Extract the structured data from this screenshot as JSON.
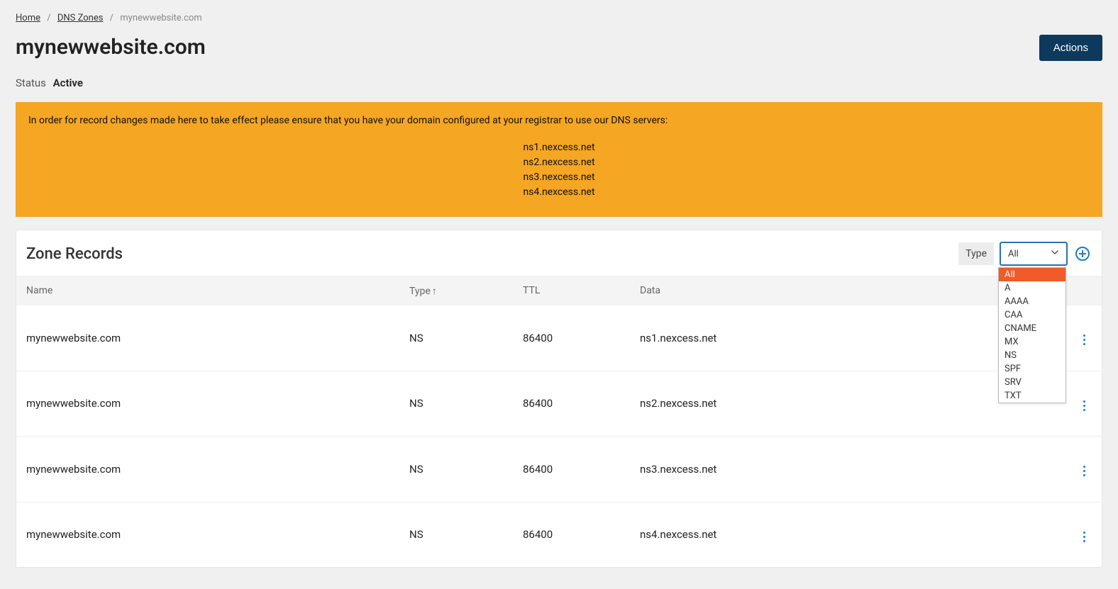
{
  "breadcrumb": {
    "home": "Home",
    "dns_zones": "DNS Zones",
    "current": "mynewwebsite.com"
  },
  "page_title": "mynewwebsite.com",
  "actions_label": "Actions",
  "status": {
    "label": "Status",
    "value": "Active"
  },
  "notice": {
    "text": "In order for record changes made here to take effect please ensure that you have your domain configured at your registrar to use our DNS servers:",
    "ns": [
      "ns1.nexcess.net",
      "ns2.nexcess.net",
      "ns3.nexcess.net",
      "ns4.nexcess.net"
    ]
  },
  "zone_records": {
    "title": "Zone Records",
    "filter": {
      "label": "Type",
      "selected": "All",
      "options": [
        "All",
        "A",
        "AAAA",
        "CAA",
        "CNAME",
        "MX",
        "NS",
        "SPF",
        "SRV",
        "TXT"
      ]
    },
    "columns": {
      "name": "Name",
      "type": "Type",
      "ttl": "TTL",
      "data": "Data",
      "sort_indicator": "↑"
    },
    "rows": [
      {
        "name": "mynewwebsite.com",
        "type": "NS",
        "ttl": "86400",
        "data": "ns1.nexcess.net"
      },
      {
        "name": "mynewwebsite.com",
        "type": "NS",
        "ttl": "86400",
        "data": "ns2.nexcess.net"
      },
      {
        "name": "mynewwebsite.com",
        "type": "NS",
        "ttl": "86400",
        "data": "ns3.nexcess.net"
      },
      {
        "name": "mynewwebsite.com",
        "type": "NS",
        "ttl": "86400",
        "data": "ns4.nexcess.net"
      }
    ]
  }
}
